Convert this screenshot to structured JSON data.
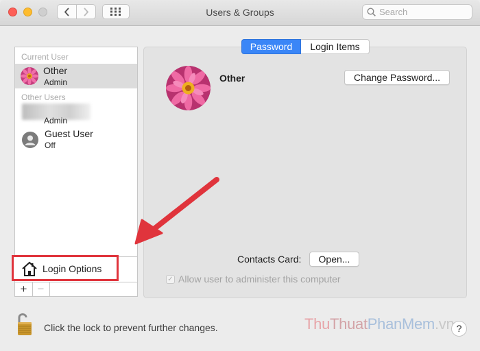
{
  "window": {
    "title": "Users & Groups",
    "search_placeholder": "Search"
  },
  "sidebar": {
    "current_user_header": "Current User",
    "current_user": {
      "name": "Other",
      "role": "Admin",
      "avatar": "pink-flower-avatar"
    },
    "other_users_header": "Other Users",
    "other_users": [
      {
        "name": "",
        "role": "Admin",
        "avatar": "blurred-avatar"
      },
      {
        "name": "Guest User",
        "role": "Off",
        "avatar": "guest-person-icon"
      }
    ],
    "login_options_label": "Login Options",
    "add_label": "+",
    "remove_label": "−"
  },
  "tabs": [
    {
      "label": "Password",
      "selected": true
    },
    {
      "label": "Login Items",
      "selected": false
    }
  ],
  "detail": {
    "user_name": "Other",
    "change_password_label": "Change Password...",
    "contacts_card_label": "Contacts Card:",
    "open_label": "Open...",
    "allow_admin_label": "Allow user to administer this computer",
    "allow_admin_checked": true
  },
  "footer": {
    "lock_text": "Click the lock to prevent further changes.",
    "help_label": "?"
  },
  "watermark": {
    "part1": "Thu",
    "part2": "Thuat",
    "part3": "PhanMem",
    "part4": ".vn"
  },
  "colors": {
    "accent": "#3a86f7",
    "highlight_red": "#e0343c"
  }
}
